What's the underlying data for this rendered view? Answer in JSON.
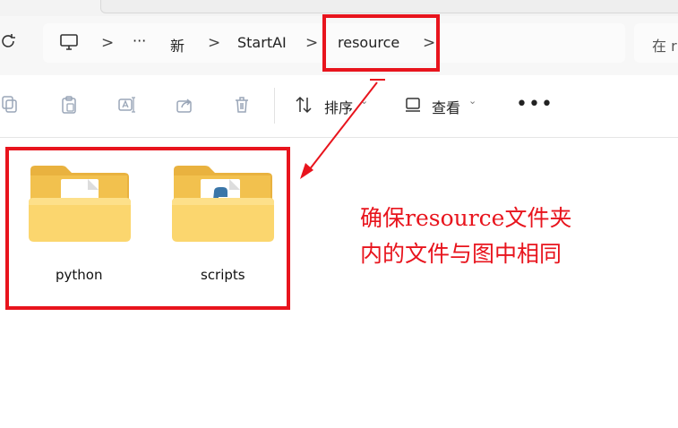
{
  "breadcrumb": {
    "items": [
      "新",
      "StartAI",
      "resource"
    ],
    "ellipsis": "···",
    "separator": ">"
  },
  "search": {
    "prefix": "在 r"
  },
  "toolbar": {
    "sort_label": "排序",
    "view_label": "查看",
    "more": "•••"
  },
  "folders": [
    {
      "name": "python"
    },
    {
      "name": "scripts"
    }
  ],
  "annotation": {
    "line1": "确保resource文件夹",
    "line2": "内的文件与图中相同",
    "color": "#e8141d"
  },
  "colors": {
    "folder_back": "#f2c14e",
    "folder_front": "#fbd66e",
    "highlight": "#e8141d"
  },
  "icons": [
    "refresh-icon",
    "this-pc-icon",
    "copy-icon",
    "paste-icon",
    "rename-icon",
    "share-icon",
    "delete-icon",
    "sort-icon",
    "view-icon",
    "more-icon",
    "folder-icon",
    "python-file-icon"
  ]
}
